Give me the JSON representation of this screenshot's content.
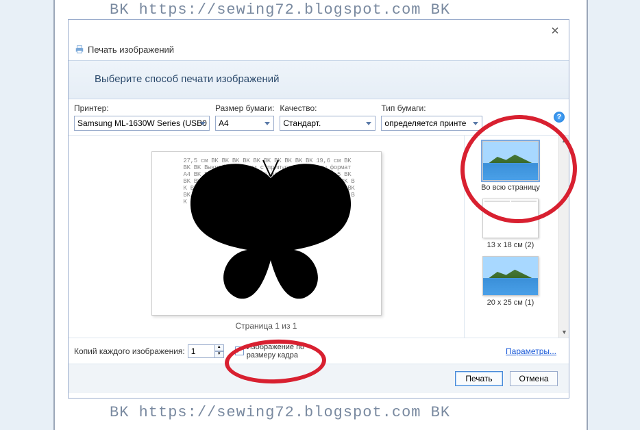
{
  "background_watermark": "BK  https://sewing72.blogspot.com BK",
  "dialog": {
    "title": "Печать изображений",
    "header": "Выберите способ печати изображений",
    "close_glyph": "✕"
  },
  "options": {
    "printer_label": "Принтер:",
    "printer_value": "Samsung ML-1630W Series (USB0",
    "paper_label": "Размер бумаги:",
    "paper_value": "A4",
    "quality_label": "Качество:",
    "quality_value": "Стандарт.",
    "type_label": "Тип бумаги:",
    "type_value": "определяется принте",
    "help_glyph": "?"
  },
  "preview": {
    "caption": "Страница 1 из 1"
  },
  "layouts": [
    {
      "label": "Во всю страницу",
      "selected": true,
      "style": "single"
    },
    {
      "label": "13 x 18 см (2)",
      "selected": false,
      "style": "double"
    },
    {
      "label": "20 x 25 см (1)",
      "selected": false,
      "style": "single"
    }
  ],
  "footer": {
    "copies_label": "Копий каждого изображения:",
    "copies_value": "1",
    "fit_label": "Изображение по размеру кадра",
    "fit_checked": true,
    "params_link": "Параметры..."
  },
  "buttons": {
    "print": "Печать",
    "cancel": "Отмена"
  }
}
